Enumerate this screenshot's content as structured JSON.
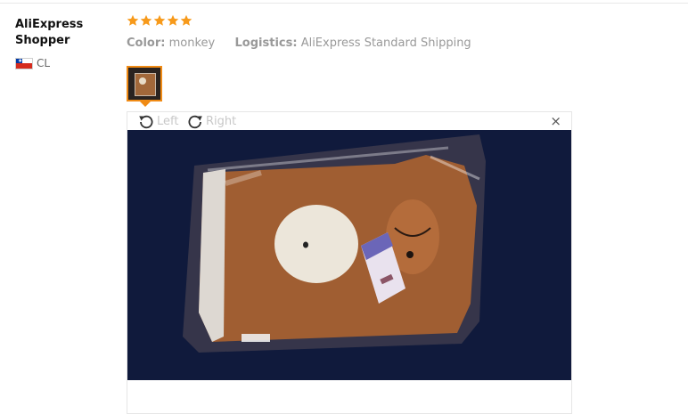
{
  "review": {
    "user_name": "AliExpress Shopper",
    "country_code": "CL",
    "rating": 5,
    "color_label": "Color:",
    "color_value": "monkey",
    "logistics_label": "Logistics:",
    "logistics_value": "AliExpress Standard Shipping"
  },
  "viewer": {
    "rotate_left_label": "Left",
    "rotate_right_label": "Right",
    "close_symbol": "×"
  },
  "icons": {
    "star": "star-icon",
    "flag": "flag-chile-icon",
    "rotate_left": "rotate-left-icon",
    "rotate_right": "rotate-right-icon",
    "close": "close-icon"
  },
  "colors": {
    "star": "#f79a1b",
    "accent_border": "#f08b15",
    "muted_text": "#999999"
  }
}
